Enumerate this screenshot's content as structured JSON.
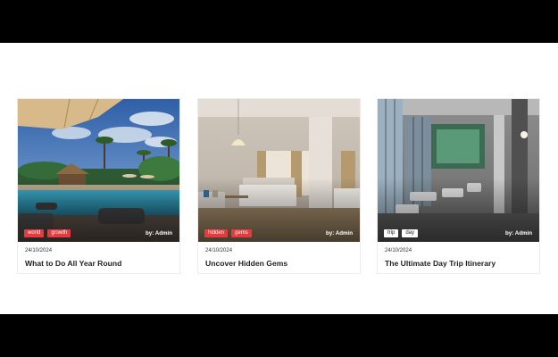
{
  "posts": [
    {
      "date": "24/10/2024",
      "title": "What to Do All Year Round",
      "byline": "by: Admin",
      "tags": [
        "world",
        "growth"
      ],
      "tag_style": "red",
      "image": "tropical-pool-resort-image"
    },
    {
      "date": "24/10/2024",
      "title": "Uncover Hidden Gems",
      "byline": "by: Admin",
      "tags": [
        "hidden",
        "gems"
      ],
      "tag_style": "red",
      "image": "hotel-bedroom-image"
    },
    {
      "date": "24/10/2024",
      "title": "The Ultimate Day Trip Itinerary",
      "byline": "by: Admin",
      "tags": [
        "trip",
        "day"
      ],
      "tag_style": "white",
      "image": "hotel-lobby-image"
    }
  ],
  "colors": {
    "tag_red": "#e53a3e",
    "letterbox": "#000000",
    "card_border": "#ececec"
  }
}
